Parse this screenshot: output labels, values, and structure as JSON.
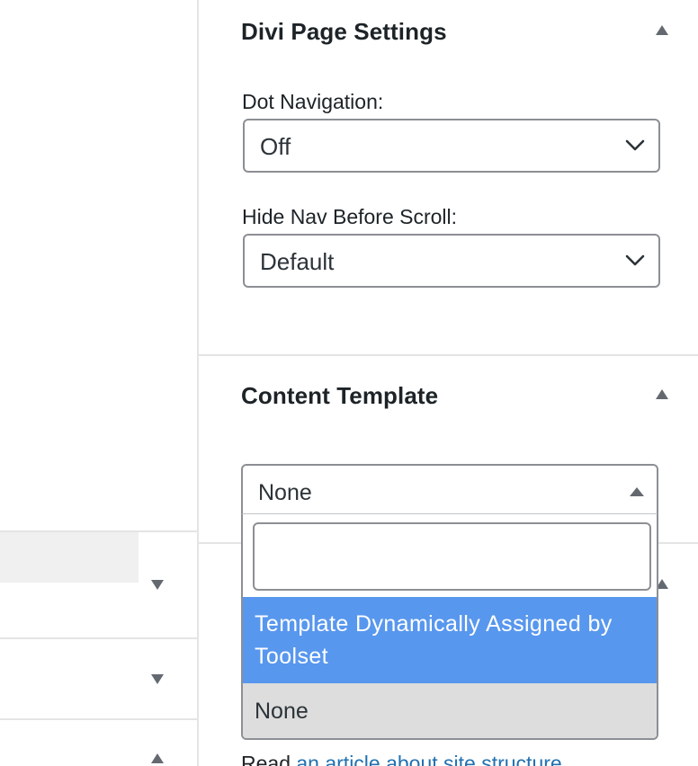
{
  "divi_settings": {
    "title": "Divi Page Settings",
    "dot_navigation": {
      "label": "Dot Navigation:",
      "value": "Off"
    },
    "hide_nav": {
      "label": "Hide Nav Before Scroll:",
      "value": "Default"
    }
  },
  "content_template": {
    "title": "Content Template",
    "selected": "None",
    "search_value": "",
    "options": [
      {
        "label": "Template Dynamically Assigned by Toolset",
        "state": "highlighted"
      },
      {
        "label": "None",
        "state": "selected"
      }
    ]
  },
  "bottom_text": {
    "prefix": "Read ",
    "link": "an article about site structure"
  },
  "colors": {
    "highlight": "#5897ee",
    "link": "#2271b1"
  },
  "icons": [
    "chevron-up-icon",
    "chevron-down-icon",
    "caret-up-icon",
    "caret-down-icon"
  ]
}
